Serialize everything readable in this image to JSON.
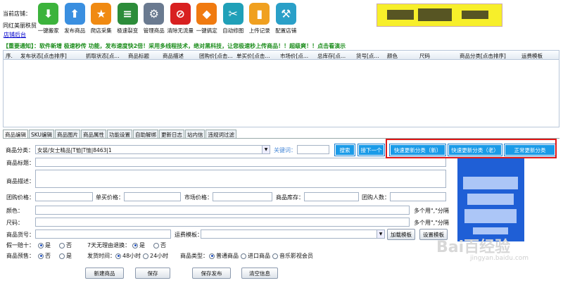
{
  "header": {
    "store_label": "当前店铺：",
    "store_name": "同红美丽秩贸",
    "store_link": "店铺后台"
  },
  "toolbar": [
    {
      "label": "一键搬家",
      "icon": "download-arrow-icon",
      "color": "#3cb33c"
    },
    {
      "label": "发布商品",
      "icon": "upload-arrow-icon",
      "color": "#3a8fe0"
    },
    {
      "label": "爬店采集",
      "icon": "star-icon",
      "color": "#f08a12"
    },
    {
      "label": "极速裂变",
      "icon": "layers-icon",
      "color": "#2c8c3a"
    },
    {
      "label": "管理商品",
      "icon": "gear-icon",
      "color": "#6a7a90"
    },
    {
      "label": "清除无流量",
      "icon": "prohibit-icon",
      "color": "#d82020"
    },
    {
      "label": "一键搞定",
      "icon": "tag-icon",
      "color": "#f07a10"
    },
    {
      "label": "自动修图",
      "icon": "scissors-icon",
      "color": "#20a0b8"
    },
    {
      "label": "上传记录",
      "icon": "bookmark-icon",
      "color": "#f0a020"
    },
    {
      "label": "配置店铺",
      "icon": "wrench-icon",
      "color": "#2aa0c8"
    }
  ],
  "notice": "【重要通知】：软件新增 极速秒传 功能，发布速度快2倍！采用多线程技术，绝对黑科技，让您极速秒上传商品！！超级爽！！点击看演示",
  "grid_columns": [
    "序.",
    "发布状态[点击排序]",
    "抓取状态[点...",
    "商品标题",
    "商品描述",
    "团购价[点击...",
    "单买价[点击...",
    "市场价[点...",
    "总库存[点...",
    "货号[点...",
    "颜色",
    "尺码",
    "商品分类[点击排序]",
    "运费模板"
  ],
  "tabs": [
    "商品编辑",
    "SKU编辑",
    "商品图片",
    "商品属性",
    "功能设置",
    "自助解绑",
    "更新日志",
    "站内信",
    "违规词过滤"
  ],
  "form": {
    "category_label": "商品分类：",
    "category_value": "女装/女士精品|T恤|T恤|8463|1",
    "keyword_label": "关键词：",
    "search_btn": "搜索",
    "next_btn": "接下一个",
    "update_new": "快速更新分类（新）",
    "update_old": "快速更新分类（老）",
    "update_normal": "正常更新分类",
    "title_label": "商品标题：",
    "desc_label": "商品描述：",
    "group_price": "团购价格：",
    "single_price": "单买价格：",
    "market_price": "市场价格：",
    "stock": "商品库存：",
    "group_people": "团购人数：",
    "color_label": "颜色：",
    "size_label": "尺码：",
    "sep_hint": "多个用\",\"分隔",
    "sku_label": "商品货号：",
    "shipping_label": "运费模板：",
    "load_tpl": "加载模板",
    "set_tpl": "设置模板",
    "fake_label": "假一赔十：",
    "yes": "是",
    "no": "否",
    "return_label": "7天无理由退换：",
    "presale_label": "商品预售：",
    "ship_time": "发货时间：",
    "h48": "48小时",
    "h24": "24小时",
    "type_label": "商品类型：",
    "type1": "普通商品",
    "type2": "进口商品",
    "type3": "音乐影视会员"
  },
  "bottom": {
    "new_btn": "新建商品",
    "save_btn": "保存",
    "save_pub_btn": "保存发布",
    "clear_btn": "清空信息"
  },
  "watermark": {
    "main": "Bai百经验",
    "sub": "jingyan.baidu.com"
  }
}
